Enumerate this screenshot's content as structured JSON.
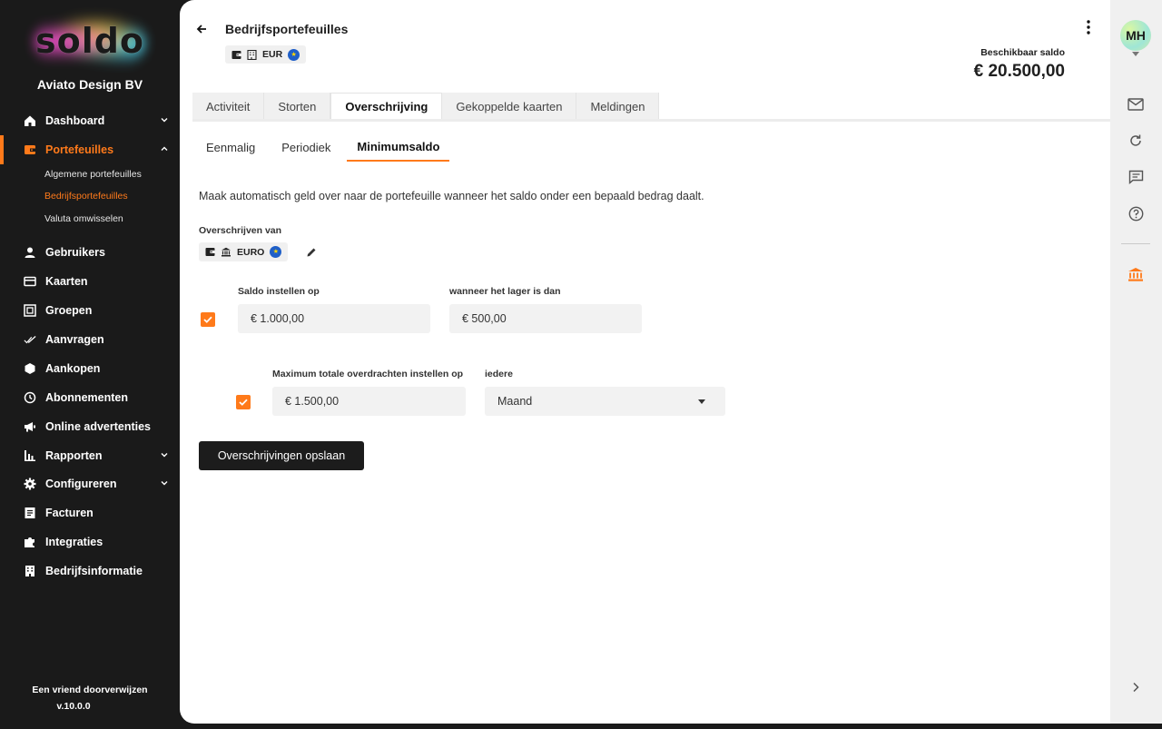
{
  "brand": {
    "logo_text": "soldo",
    "company": "Aviato Design BV"
  },
  "sidebar": {
    "items": [
      {
        "label": "Dashboard",
        "icon": "home-icon",
        "has_chevron": true
      },
      {
        "label": "Portefeuilles",
        "icon": "wallet-icon",
        "has_chevron": true,
        "active": true
      },
      {
        "label": "Gebruikers",
        "icon": "user-icon"
      },
      {
        "label": "Kaarten",
        "icon": "card-icon"
      },
      {
        "label": "Groepen",
        "icon": "groups-icon"
      },
      {
        "label": "Aanvragen",
        "icon": "double-check-icon"
      },
      {
        "label": "Aankopen",
        "icon": "hexagon-icon"
      },
      {
        "label": "Abonnementen",
        "icon": "clock-icon"
      },
      {
        "label": "Online advertenties",
        "icon": "megaphone-icon"
      },
      {
        "label": "Rapporten",
        "icon": "bar-chart-icon",
        "has_chevron": true
      },
      {
        "label": "Configureren",
        "icon": "gear-icon",
        "has_chevron": true
      },
      {
        "label": "Facturen",
        "icon": "invoice-icon"
      },
      {
        "label": "Integraties",
        "icon": "puzzle-icon"
      },
      {
        "label": "Bedrijfsinformatie",
        "icon": "building-icon"
      }
    ],
    "sub_items": [
      "Algemene portefeuilles",
      "Bedrijfsportefeuilles",
      "Valuta omwisselen"
    ],
    "refer": "Een vriend doorverwijzen",
    "version": "v.10.0.0"
  },
  "header": {
    "title": "Bedrijfsportefeuilles",
    "wallet_currency": "EUR",
    "balance_label": "Beschikbaar saldo",
    "balance_amount": "€ 20.500,00"
  },
  "tabs": [
    "Activiteit",
    "Storten",
    "Overschrijving",
    "Gekoppelde kaarten",
    "Meldingen"
  ],
  "active_tab": "Overschrijving",
  "subtabs": [
    "Eenmalig",
    "Periodiek",
    "Minimumsaldo"
  ],
  "active_subtab": "Minimumsaldo",
  "form": {
    "description": "Maak automatisch geld over naar de portefeuille wanneer het saldo onder een bepaald bedrag daalt.",
    "from_label": "Overschrijven van",
    "from_currency": "EURO",
    "set_balance_label": "Saldo instellen op",
    "set_balance_value": "€ 1.000,00",
    "threshold_label": "wanneer het lager is dan",
    "threshold_value": "€ 500,00",
    "max_label": "Maximum totale overdrachten instellen op",
    "max_value": "€ 1.500,00",
    "period_label": "iedere",
    "period_value": "Maand",
    "save_label": "Overschrijvingen opslaan"
  },
  "rail": {
    "avatar_initials": "MH"
  },
  "colors": {
    "accent": "#ff7a1a",
    "sidebar_bg": "#1a1a1a",
    "eu_blue": "#1f5fc8"
  }
}
